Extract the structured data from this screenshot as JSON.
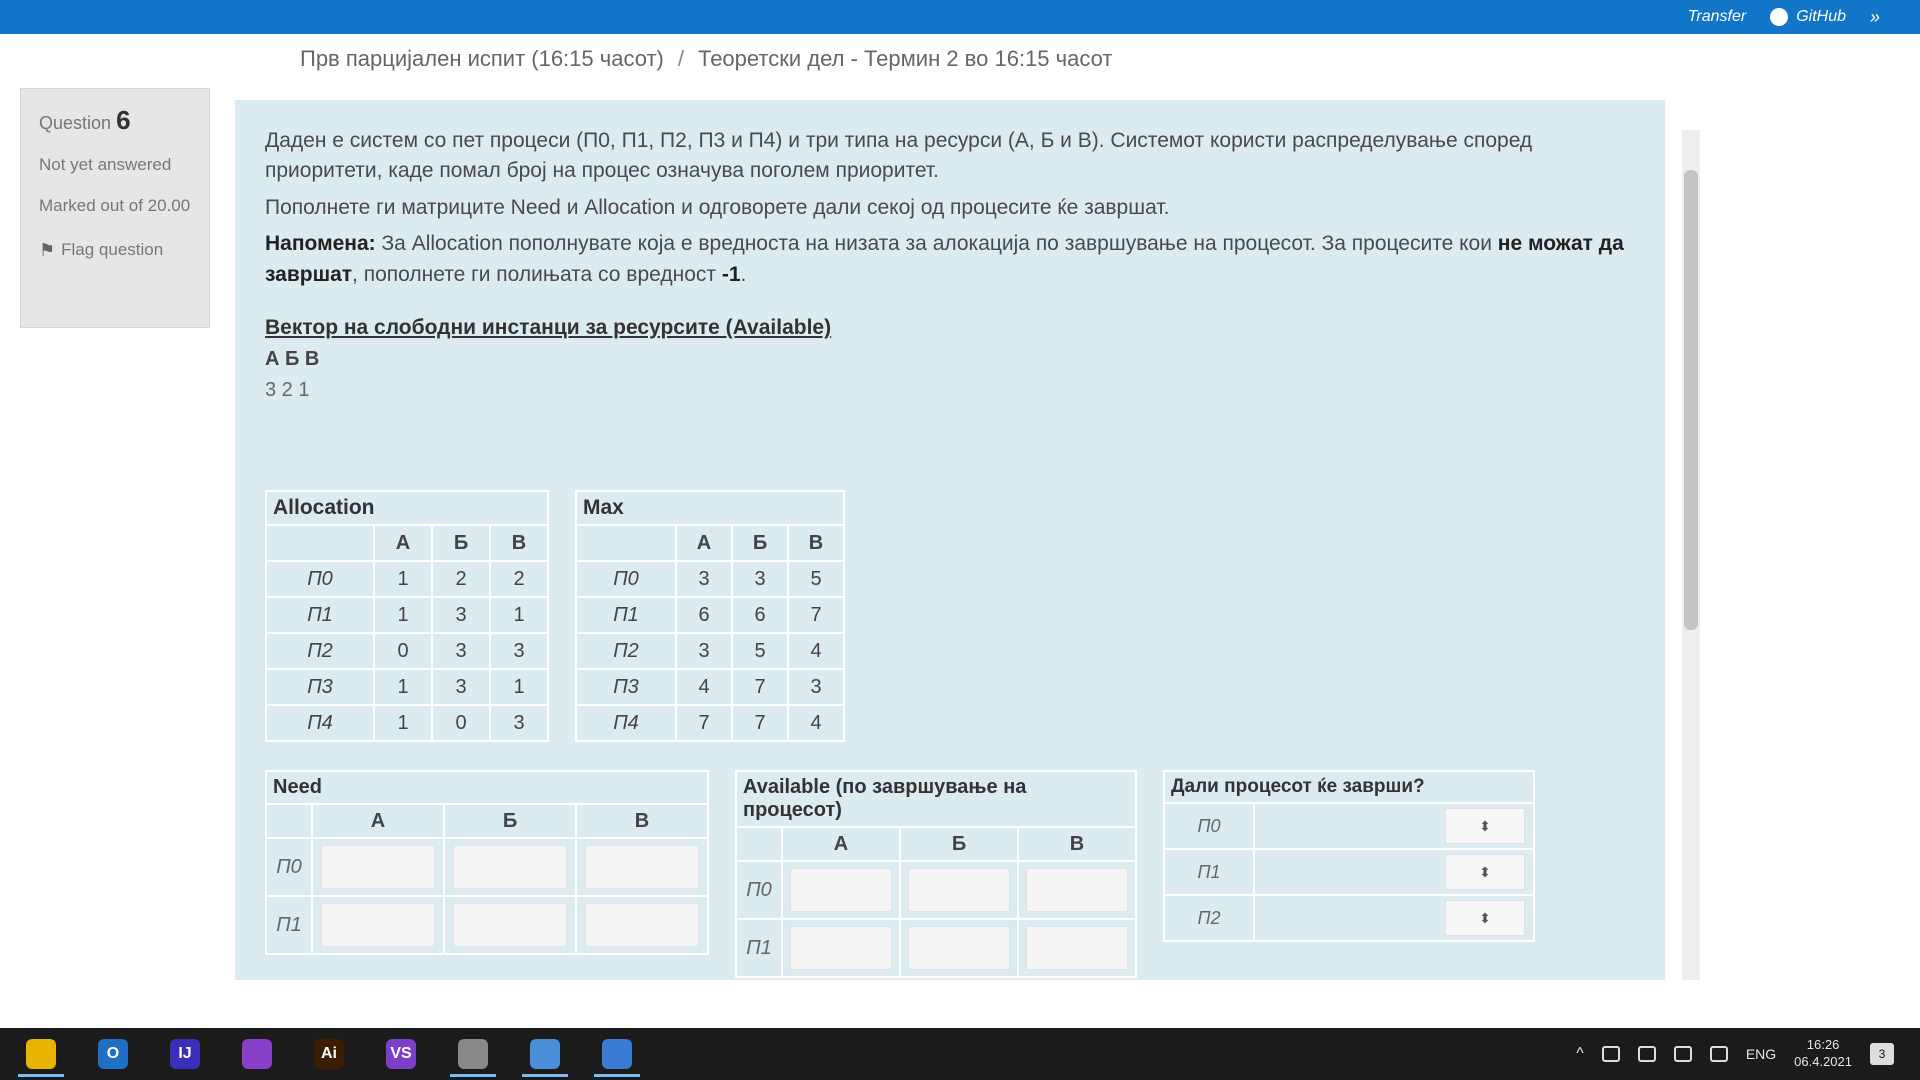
{
  "bookmarks": [
    {
      "label": "Transfer",
      "icon": "transfer-icon"
    },
    {
      "label": "GitHub",
      "icon": "github-icon"
    }
  ],
  "breadcrumb": {
    "item1": "Прв парцијален испит (16:15 часот)",
    "separator": "/",
    "item2": "Теоретски дел - Термин 2 во 16:15 часот"
  },
  "question_info": {
    "label": "Question",
    "number": "6",
    "state": "Not yet answered",
    "marks": "Marked out of 20.00",
    "flag": "Flag question"
  },
  "question": {
    "paragraph1": "Даден е систем со пет процеси (П0, П1, П2, П3 и П4) и три типа на ресурси (А, Б и В). Системот користи распределување според приоритети, каде помал број на процес означува поголем приоритет.",
    "paragraph2": "Пополнете ги матриците Need и Allocation и одговорете дали секој од процесите ќе завршат.",
    "note_label": "Напомена:",
    "note_text": " За Allocation пополнувате која е вредноста на низата за алокација по завршување на процесот. За процесите кои ",
    "note_strong": "не можат да завршат",
    "note_end": ", пополнете ги полињата со вредност ",
    "note_value": "-1",
    "note_period": "."
  },
  "available_vector": {
    "title": "Вектор на слободни инстанци за ресурсите (Available)",
    "letters": "А Б В",
    "values": "3 2 1"
  },
  "allocation": {
    "caption": "Allocation",
    "headers": [
      "А",
      "Б",
      "В"
    ],
    "rows": [
      {
        "label": "П0",
        "values": [
          "1",
          "2",
          "2"
        ]
      },
      {
        "label": "П1",
        "values": [
          "1",
          "3",
          "1"
        ]
      },
      {
        "label": "П2",
        "values": [
          "0",
          "3",
          "3"
        ]
      },
      {
        "label": "П3",
        "values": [
          "1",
          "3",
          "1"
        ]
      },
      {
        "label": "П4",
        "values": [
          "1",
          "0",
          "3"
        ]
      }
    ]
  },
  "max": {
    "caption": "Max",
    "headers": [
      "А",
      "Б",
      "В"
    ],
    "rows": [
      {
        "label": "П0",
        "values": [
          "3",
          "3",
          "5"
        ]
      },
      {
        "label": "П1",
        "values": [
          "6",
          "6",
          "7"
        ]
      },
      {
        "label": "П2",
        "values": [
          "3",
          "5",
          "4"
        ]
      },
      {
        "label": "П3",
        "values": [
          "4",
          "7",
          "3"
        ]
      },
      {
        "label": "П4",
        "values": [
          "7",
          "7",
          "4"
        ]
      }
    ]
  },
  "need": {
    "caption": "Need",
    "headers": [
      "А",
      "Б",
      "В"
    ],
    "rows": [
      "П0",
      "П1"
    ]
  },
  "available_after": {
    "caption": "Available (по завршување на процесот)",
    "headers": [
      "А",
      "Б",
      "В"
    ],
    "rows": [
      "П0",
      "П1"
    ]
  },
  "finish": {
    "caption": "Дали процесот ќе заврши?",
    "rows": [
      "П0",
      "П1",
      "П2"
    ],
    "select_glyph": "⬍"
  },
  "taskbar": {
    "apps": [
      {
        "name": "chrome-icon",
        "label": "",
        "color": "#e8b400",
        "active": true
      },
      {
        "name": "outlook-icon",
        "label": "O",
        "color": "#1f6fc5",
        "active": false
      },
      {
        "name": "intellij-icon",
        "label": "IJ",
        "color": "#3a2fb8",
        "active": false
      },
      {
        "name": "github-desktop-icon",
        "label": "",
        "color": "#8a3fc9",
        "active": false
      },
      {
        "name": "illustrator-icon",
        "label": "Ai",
        "color": "#3b1d02",
        "active": false
      },
      {
        "name": "visual-studio-icon",
        "label": "VS",
        "color": "#7b3fc9",
        "active": false
      },
      {
        "name": "file-explorer-icon",
        "label": "",
        "color": "#888888",
        "active": true
      },
      {
        "name": "chrome-app-icon",
        "label": "",
        "color": "#4a90d9",
        "active": true
      },
      {
        "name": "calculator-icon",
        "label": "",
        "color": "#3a7bd5",
        "active": true
      }
    ],
    "tray": {
      "language": "ENG",
      "time": "16:26",
      "date": "06.4.2021",
      "notifications": "3"
    }
  }
}
